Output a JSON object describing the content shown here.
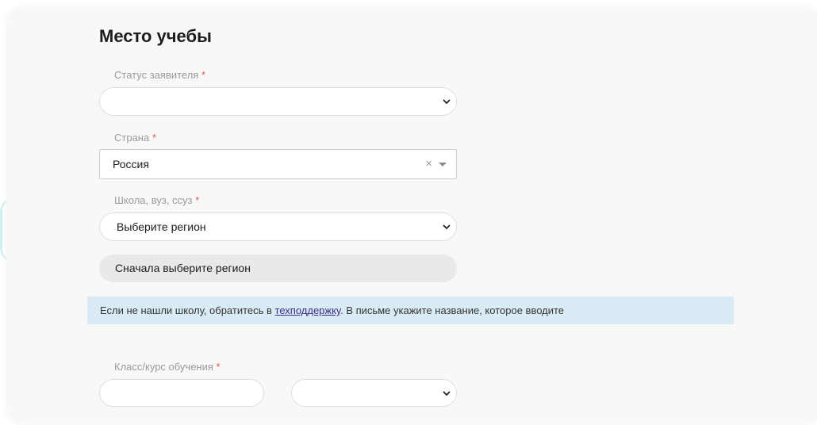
{
  "section": {
    "title": "Место учебы"
  },
  "fields": {
    "status": {
      "label": "Статус заявителя",
      "required_mark": "*",
      "value": ""
    },
    "country": {
      "label": "Страна",
      "required_mark": "*",
      "value": "Россия",
      "clear_symbol": "×"
    },
    "school": {
      "label": "Школа, вуз, ссуз",
      "required_mark": "*",
      "region_value": "Выберите регион",
      "disabled_text": "Сначала выберите регион"
    },
    "grade": {
      "label": "Класс/курс обучения",
      "required_mark": "*",
      "input_value": "",
      "select_value": ""
    }
  },
  "info": {
    "text_before": "Если не нашли школу, обратитесь в ",
    "link_text": "техподдержку",
    "text_after": ". В письме  укажите название, которое вводите"
  },
  "icons": [
    "chevron-down-icon",
    "clear-icon",
    "caret-down-icon"
  ]
}
